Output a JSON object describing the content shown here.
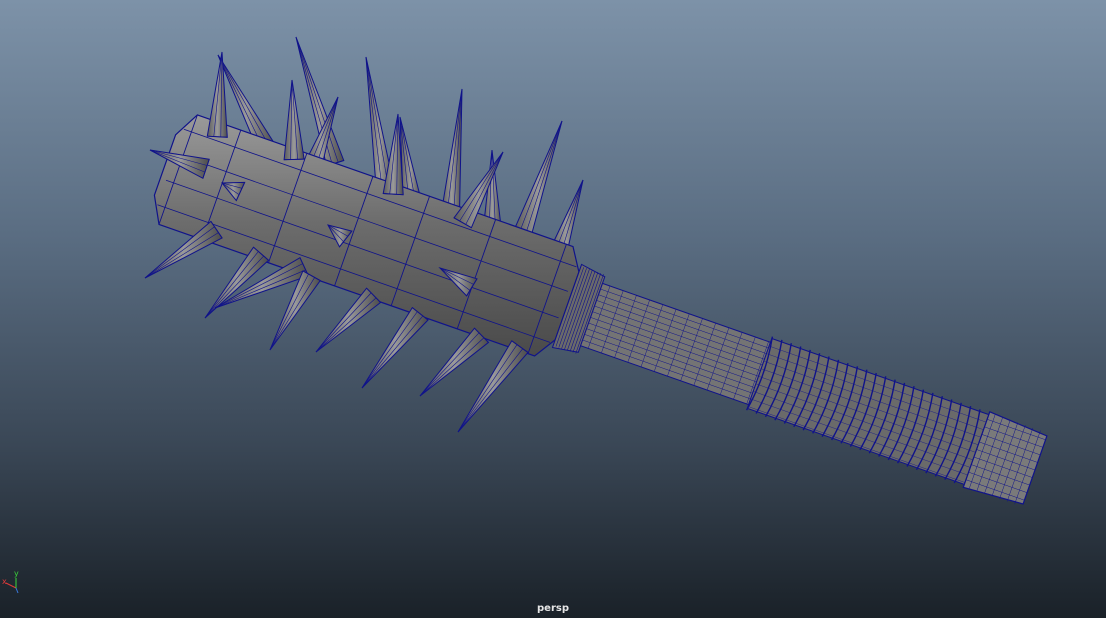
{
  "viewport": {
    "camera": "persp",
    "axes": {
      "x": "x",
      "y": "y",
      "z": "z"
    },
    "colors": {
      "wireframe": "#10138a",
      "mesh_fill": "#6e6e6e",
      "x_axis": "#e03a3a",
      "y_axis": "#3ad43a",
      "z_axis": "#3a7ae0"
    }
  },
  "model": {
    "object": "spiked-mace",
    "parts": [
      "spiked-head",
      "collar",
      "grip-shaft",
      "ribbed-grip",
      "pommel"
    ]
  }
}
